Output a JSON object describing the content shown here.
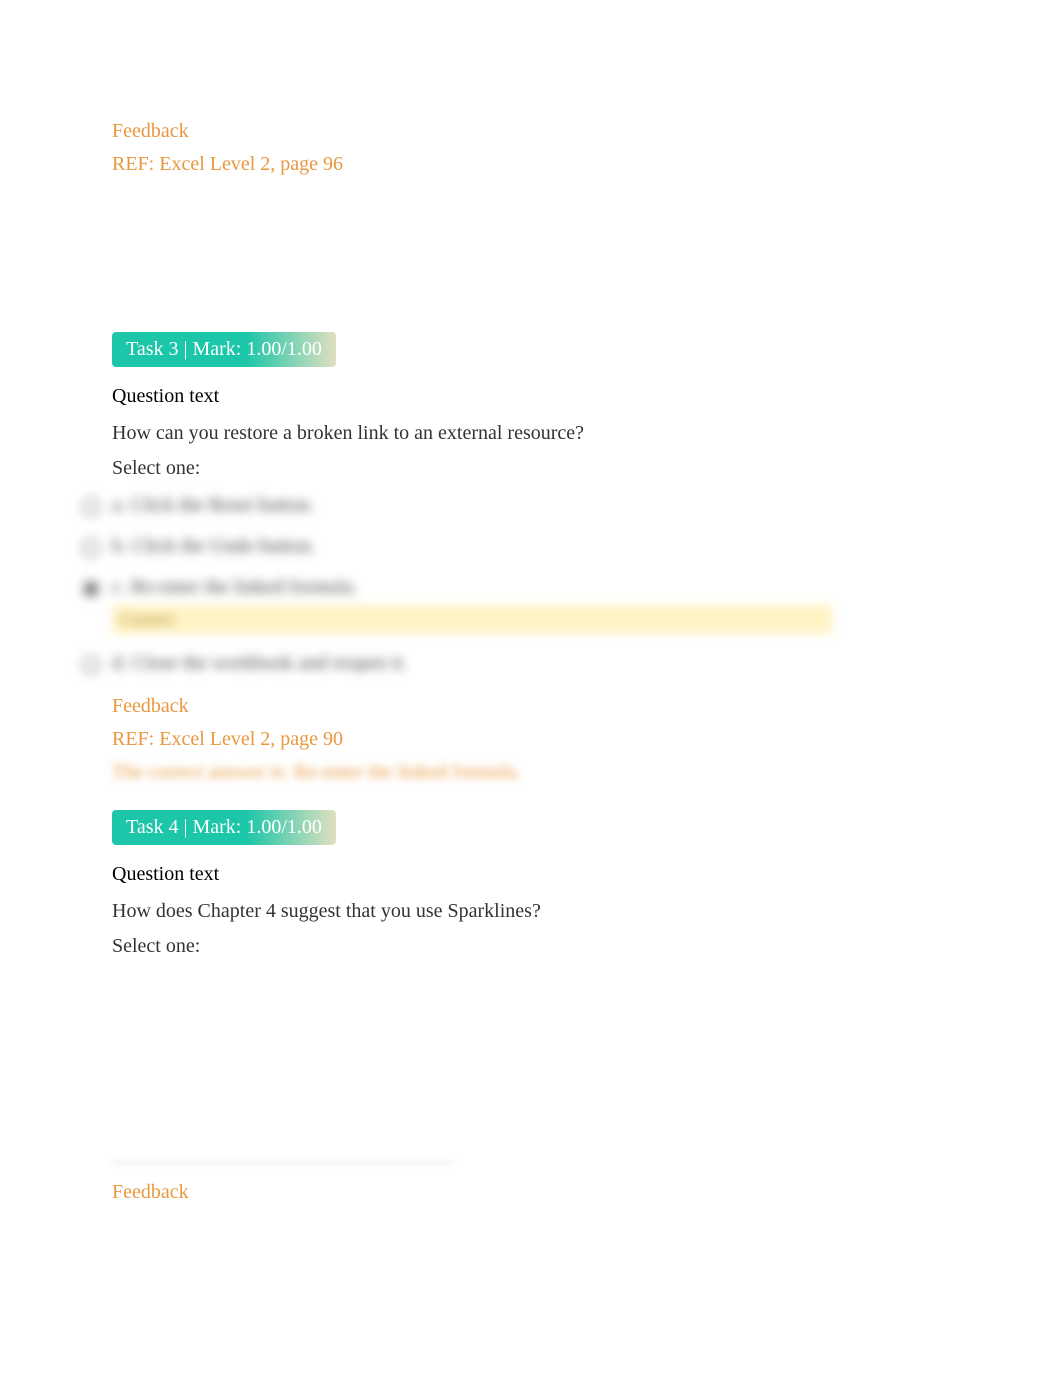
{
  "task2": {
    "feedback": {
      "heading": "Feedback",
      "ref": "REF: Excel Level 2, page 96"
    }
  },
  "task3": {
    "badge": "Task 3 | Mark: 1.00/1.00",
    "questionHeading": "Question text",
    "questionText": "How can you restore a broken link to an external resource?",
    "prompt": "Select one:",
    "options": [
      {
        "letter": "a.",
        "label": "Click the Reset button.",
        "selected": false,
        "correct": false
      },
      {
        "letter": "b.",
        "label": "Click the Undo button.",
        "selected": false,
        "correct": false
      },
      {
        "letter": "c.",
        "label": "Re-enter the linked formula.",
        "selected": true,
        "correct": true,
        "correctLabel": "Correct"
      },
      {
        "letter": "d.",
        "label": "Close the workbook and reopen it.",
        "selected": false,
        "correct": false
      }
    ],
    "feedback": {
      "heading": "Feedback",
      "ref": "REF: Excel Level 2, page 90",
      "correctAnswer": "The correct answer is: Re-enter the linked formula."
    }
  },
  "task4": {
    "badge": "Task 4 | Mark: 1.00/1.00",
    "questionHeading": "Question text",
    "questionText": "How does Chapter 4 suggest that you use Sparklines?",
    "prompt": "Select one:",
    "feedback": {
      "heading": "Feedback"
    }
  }
}
